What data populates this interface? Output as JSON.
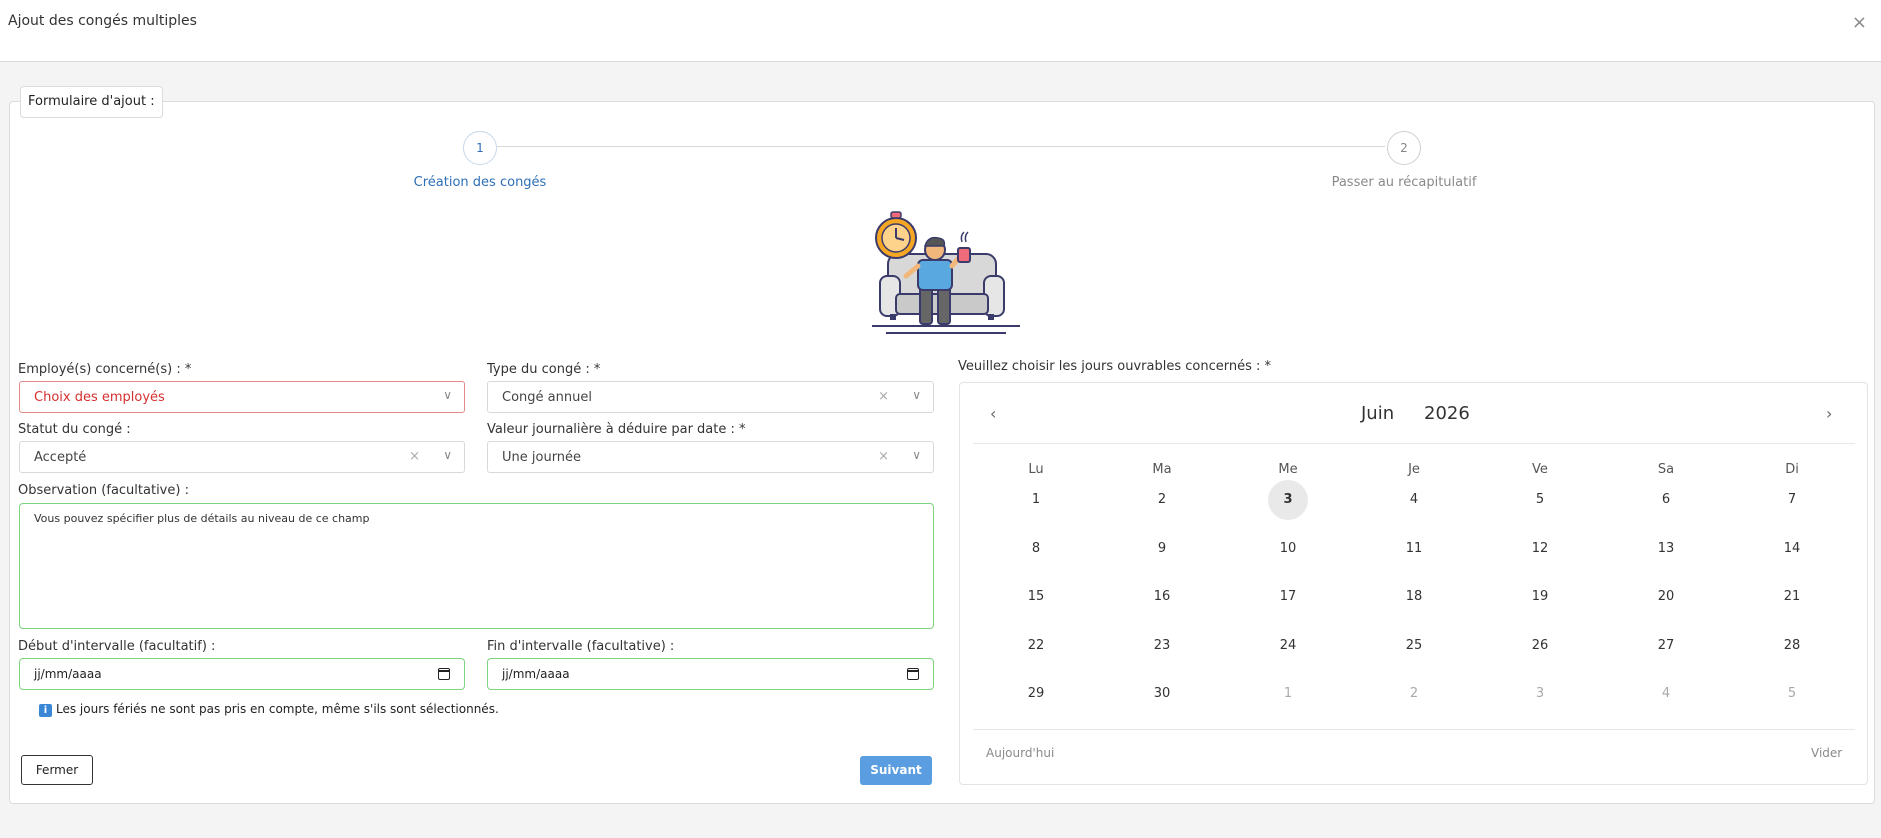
{
  "modal": {
    "title": "Ajout des congés multiples",
    "close_glyph": "×"
  },
  "form": {
    "legend": "Formulaire d'ajout :"
  },
  "stepper": {
    "steps": [
      {
        "number": "1",
        "label": "Création des congés",
        "active": true
      },
      {
        "number": "2",
        "label": "Passer au récapitulatif",
        "active": false
      }
    ]
  },
  "fields": {
    "employees": {
      "label": "Employé(s) concerné(s) : *",
      "value": "Choix des employés"
    },
    "leave_type": {
      "label": "Type du congé : *",
      "value": "Congé annuel"
    },
    "status": {
      "label": "Statut du congé :",
      "value": "Accepté"
    },
    "daily_value": {
      "label": "Valeur journalière à déduire par date : *",
      "value": "Une journée"
    },
    "observation": {
      "label": "Observation (facultative) :",
      "value": "Vous pouvez spécifier plus de détails au niveau de ce champ"
    },
    "start": {
      "label": "Début d'intervalle (facultatif) :",
      "value": "jj/mm/aaaa"
    },
    "end": {
      "label": "Fin d'intervalle (facultative) :",
      "value": "jj/mm/aaaa"
    }
  },
  "info": {
    "icon": "info-icon",
    "text": "Les jours fériés ne sont pas pris en compte, même s'ils sont sélectionnés."
  },
  "buttons": {
    "close": "Fermer",
    "next": "Suivant"
  },
  "calendar": {
    "label": "Veuillez choisir les jours ouvrables concernés : *",
    "month": "Juin",
    "year": "2026",
    "weekdays": [
      "Lu",
      "Ma",
      "Me",
      "Je",
      "Ve",
      "Sa",
      "Di"
    ],
    "today": "3",
    "weeks": [
      [
        "1",
        "2",
        "3",
        "4",
        "5",
        "6",
        "7"
      ],
      [
        "8",
        "9",
        "10",
        "11",
        "12",
        "13",
        "14"
      ],
      [
        "15",
        "16",
        "17",
        "18",
        "19",
        "20",
        "21"
      ],
      [
        "22",
        "23",
        "24",
        "25",
        "26",
        "27",
        "28"
      ],
      [
        "29",
        "30",
        "1",
        "2",
        "3",
        "4",
        "5"
      ]
    ],
    "other_month_cells": 5,
    "today_label": "Aujourd'hui",
    "clear_label": "Vider"
  },
  "colors": {
    "accent": "#2e6fb8",
    "primary_button": "#5a9de0",
    "error": "#d62f2f",
    "valid_border": "#7fd47f"
  }
}
